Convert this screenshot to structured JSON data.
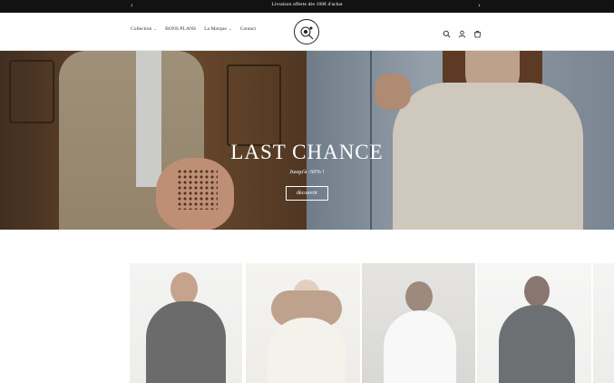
{
  "announcement": {
    "message": "Livraison offerte dès 100€ d'achat",
    "prev_label": "‹",
    "next_label": "›"
  },
  "nav": {
    "items": [
      {
        "label": "Collection",
        "has_dropdown": true
      },
      {
        "label": "BONS PLANS",
        "has_dropdown": false
      },
      {
        "label": "La Marque",
        "has_dropdown": true
      },
      {
        "label": "Contact",
        "has_dropdown": false
      }
    ],
    "chevron": "⌄"
  },
  "logo": {
    "name": "brand-logo"
  },
  "header_icons": [
    "search-icon",
    "account-icon",
    "cart-icon"
  ],
  "hero": {
    "title": "LAST CHANCE",
    "subtitle": "Jusqu'à -50% !",
    "button_label": "découvrir"
  },
  "products": [
    {
      "name": "product-card-man-black-sweater"
    },
    {
      "name": "product-card-woman-cream-sweater"
    },
    {
      "name": "product-card-man-white-shirt"
    },
    {
      "name": "product-card-man-black-polo"
    }
  ],
  "colors": {
    "announcement_bg": "#121212",
    "text_dark": "#222222",
    "white": "#ffffff"
  }
}
